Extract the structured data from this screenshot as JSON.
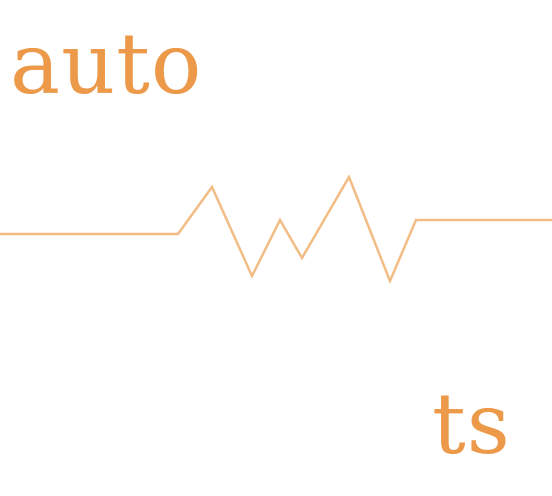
{
  "words": {
    "top": "auto",
    "bottom": "ts"
  },
  "colors": {
    "text": "#ec9a4a",
    "line": "#f2bd85",
    "background": "#ffffff"
  }
}
